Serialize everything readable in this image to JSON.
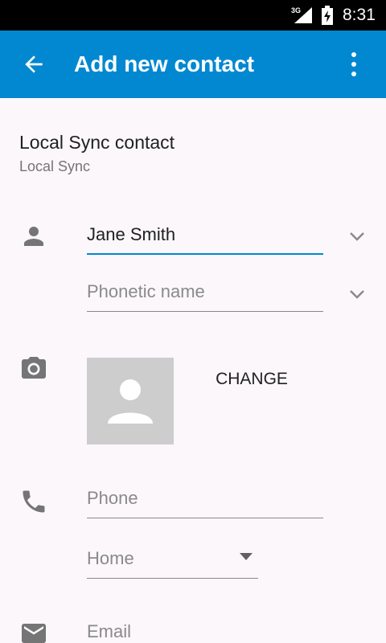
{
  "status_bar": {
    "network": "3G",
    "time": "8:31"
  },
  "app_bar": {
    "title": "Add new contact"
  },
  "account": {
    "name": "Local Sync contact",
    "type": "Local Sync"
  },
  "name_section": {
    "name_value": "Jane Smith",
    "phonetic_placeholder": "Phonetic name"
  },
  "photo_section": {
    "change_label": "CHANGE"
  },
  "phone_section": {
    "phone_placeholder": "Phone",
    "type_selected": "Home"
  },
  "email_section": {
    "email_placeholder": "Email"
  },
  "colors": {
    "app_bar": "#0288d1",
    "accent": "#0288d1",
    "background": "#fbf7fb",
    "icon": "#757575"
  }
}
